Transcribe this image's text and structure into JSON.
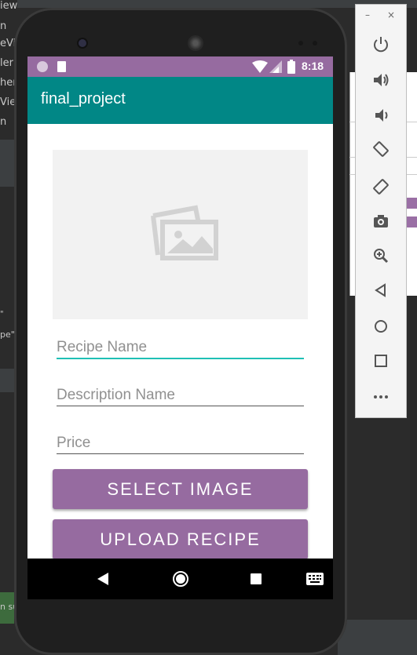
{
  "ide": {
    "left_fragments": [
      "iew",
      "n",
      "eVi",
      "ler",
      "her",
      "Vie",
      "n",
      "\"",
      "pe\"",
      "n su"
    ]
  },
  "emulator_toolbar": {
    "minimize_label": "–",
    "close_label": "×"
  },
  "status_bar": {
    "time": "8:18"
  },
  "app_bar": {
    "title": "final_project"
  },
  "form": {
    "recipe_name_placeholder": "Recipe Name",
    "description_placeholder": "Description Name",
    "price_placeholder": "Price",
    "select_image_label": "SELECT IMAGE",
    "upload_recipe_label": "UPLOAD RECIPE"
  },
  "colors": {
    "status_bar": "#966ba0",
    "app_bar": "#018786",
    "button": "#966ba0",
    "accent": "#1fc0b5"
  }
}
